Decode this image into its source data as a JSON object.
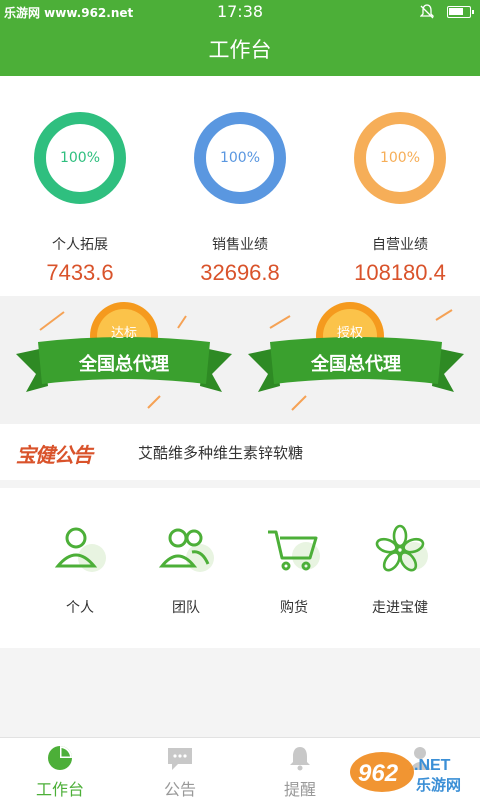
{
  "status_bar": {
    "watermark": "乐游网 www.962.net",
    "time": "17:38"
  },
  "header": {
    "title": "工作台"
  },
  "stats": [
    {
      "label": "个人拓展",
      "value": "7433.6",
      "percent_text": "100%",
      "color": "#2fbf7f"
    },
    {
      "label": "销售业绩",
      "value": "32696.8",
      "percent_text": "100%",
      "color": "#5a97e0"
    },
    {
      "label": "自营业绩",
      "value": "108180.4",
      "percent_text": "100%",
      "color": "#f6ae58"
    }
  ],
  "awards": [
    {
      "badge": "达标",
      "title": "全国总代理"
    },
    {
      "badge": "授权",
      "title": "全国总代理"
    }
  ],
  "notice": {
    "brand": "宝健公告",
    "text": "艾酷维多种维生素锌软糖"
  },
  "menu": [
    {
      "label": "个人",
      "icon": "person-icon"
    },
    {
      "label": "团队",
      "icon": "team-icon"
    },
    {
      "label": "购货",
      "icon": "cart-icon"
    },
    {
      "label": "走进宝健",
      "icon": "flower-icon"
    }
  ],
  "tabs": [
    {
      "label": "工作台",
      "icon": "pie-chart-icon",
      "active": true
    },
    {
      "label": "公告",
      "icon": "chat-icon",
      "active": false
    },
    {
      "label": "提醒",
      "icon": "bell-icon",
      "active": false
    },
    {
      "label": "",
      "icon": "user-icon",
      "active": false
    }
  ],
  "watermark": {
    "number": "962",
    "suffix": ".NET",
    "site": "乐游网"
  },
  "colors": {
    "primary": "#4caf38",
    "value_red": "#d9532b",
    "ribbon_green": "#3aa02e",
    "medal_orange": "#f59a1e"
  }
}
